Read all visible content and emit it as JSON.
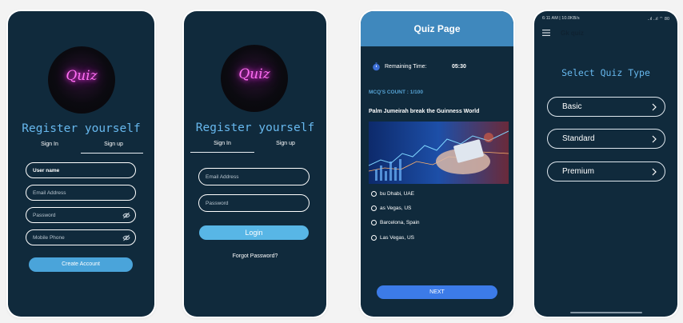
{
  "register_screen": {
    "logo_text": "Quiz",
    "title": "Register yourself",
    "tabs": [
      "Sign In",
      "Sign up"
    ],
    "active_tab": "Sign up",
    "fields": [
      {
        "label": "User name",
        "has_eye": false
      },
      {
        "label": "Email Address",
        "has_eye": false
      },
      {
        "label": "Password",
        "has_eye": true
      },
      {
        "label": "Mobile Phone",
        "has_eye": true
      }
    ],
    "button": "Create Account"
  },
  "signin_screen": {
    "logo_text": "Quiz",
    "title": "Register yourself",
    "tabs": [
      "Sign In",
      "Sign up"
    ],
    "active_tab": "Sign In",
    "fields": [
      "Email Address",
      "Password"
    ],
    "button": "Login",
    "forgot": "Forgot Password?"
  },
  "quiz_screen": {
    "header": "Quiz Page",
    "timer_label": "Remaining Time:",
    "timer_value": "05:30",
    "mcq_count": "MCQ'S COUNT :   1/100",
    "question": "Palm Jumeirah break the Guinness World",
    "options": [
      "bu Dhabi, UAE",
      "as Vegas, US",
      "Barcelona, Spain",
      "Las Vegas, US"
    ],
    "next": "NEXT"
  },
  "quiz_type_screen": {
    "status_left": "6:11 AM | 10.0KB/s",
    "status_right": "..ıl ..ıl  ⌔ 80",
    "app_title": "Gk quiz",
    "title": "Select Quiz Type",
    "types": [
      "Basic",
      "Standard",
      "Premium"
    ]
  },
  "colors": {
    "background": "#102a3c",
    "accent": "#67b8ee",
    "button": "#4aa4da",
    "quiz_header": "#3f88bd",
    "next_button": "#3c7be8",
    "neon": "#ff6ff4"
  }
}
